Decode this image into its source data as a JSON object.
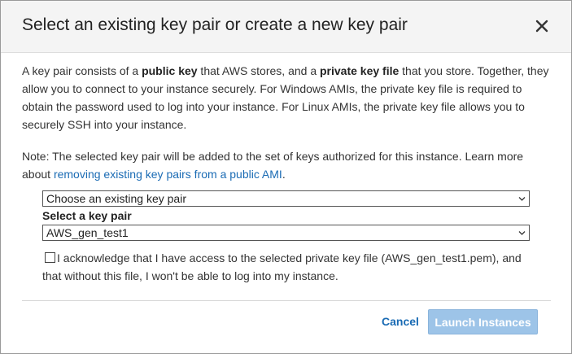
{
  "dialog": {
    "title": "Select an existing key pair or create a new key pair",
    "close_glyph": "✕"
  },
  "description": {
    "p1": "A key pair consists of a ",
    "b1": "public key",
    "p2": " that AWS stores, and a ",
    "b2": "private key file",
    "p3": " that you store. Together, they allow you to connect to your instance securely. For Windows AMIs, the private key file is required to obtain the password used to log into your instance. For Linux AMIs, the private key file allows you to securely SSH into your instance."
  },
  "note": {
    "text": "Note: The selected key pair will be added to the set of keys authorized for this instance. Learn more about ",
    "link": "removing existing key pairs from a public AMI",
    "suffix": "."
  },
  "key_pair_mode_select": {
    "value": "Choose an existing key pair"
  },
  "key_pair_select": {
    "label": "Select a key pair",
    "value": "AWS_gen_test1"
  },
  "acknowledge": {
    "checked": false,
    "text": "I acknowledge that I have access to the selected private key file (AWS_gen_test1.pem), and that without this file, I won't be able to log into my instance."
  },
  "footer": {
    "cancel_label": "Cancel",
    "launch_label": "Launch Instances",
    "launch_enabled": false
  },
  "colors": {
    "link": "#1a6bb4",
    "launch_disabled_bg": "#9dc4e8",
    "header_bg": "#f4f4f4"
  },
  "icons": {
    "close": "close-icon",
    "select_chevron": "chevron-down-icon"
  }
}
